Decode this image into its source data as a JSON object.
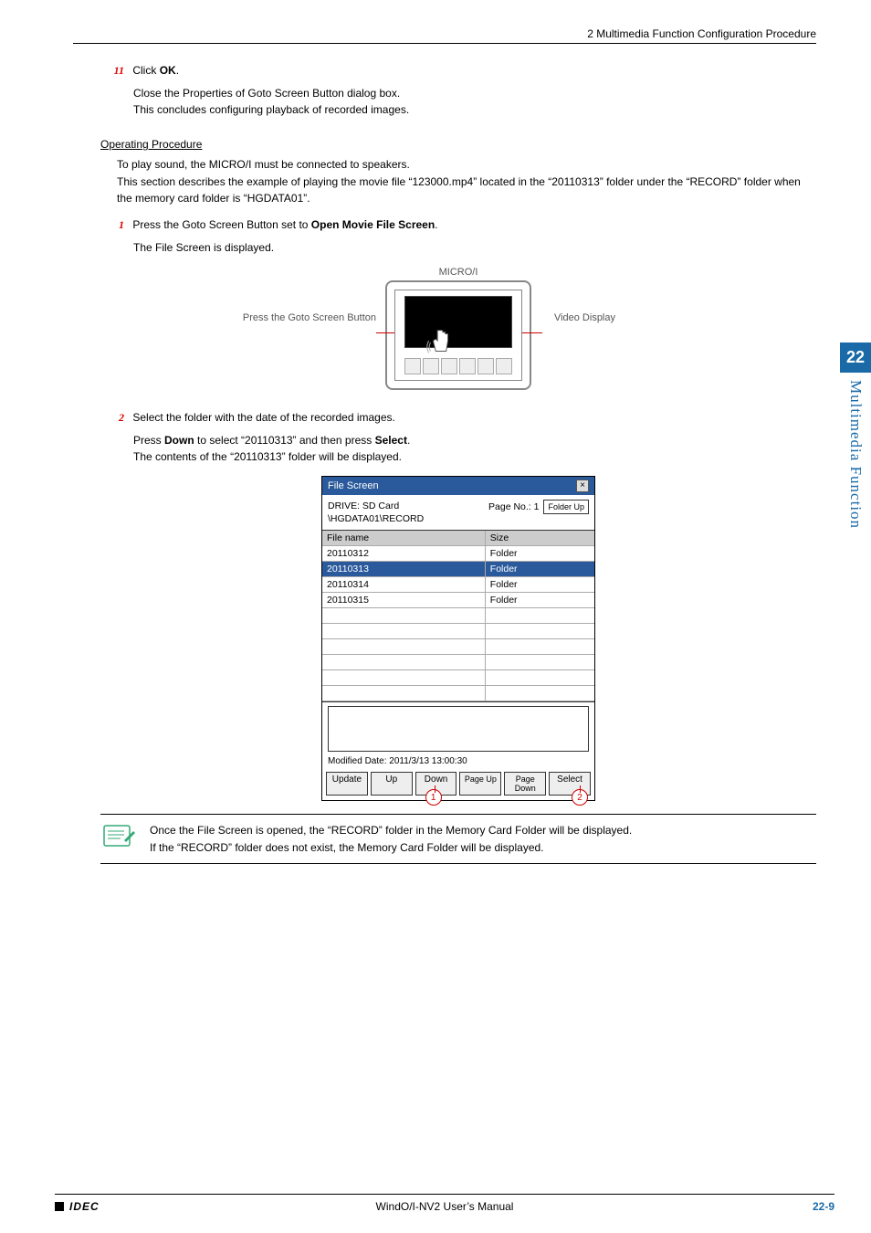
{
  "header": {
    "section_title": "2 Multimedia Function Configuration Procedure"
  },
  "step11": {
    "num": "11",
    "text_prefix": "Click ",
    "text_bold": "OK",
    "text_suffix": ".",
    "body_1": "Close the Properties of Goto Screen Button dialog box.",
    "body_2": "This concludes configuring playback of recorded images."
  },
  "op_heading": "Operating Procedure",
  "op_body_1": "To play sound, the MICRO/I must be connected to speakers.",
  "op_body_2": "This section describes the example of playing the movie file “123000.mp4” located in the “20110313” folder under the “RECORD” folder when the memory card folder is “HGDATA01”.",
  "step1": {
    "num": "1",
    "text_prefix": "Press the Goto Screen Button set to ",
    "text_bold": "Open Movie File Screen",
    "text_suffix": ".",
    "body_1": "The File Screen is displayed."
  },
  "diagram": {
    "title": "MICRO/I",
    "left_callout": "Press the Goto Screen Button",
    "right_callout": "Video Display"
  },
  "step2": {
    "num": "2",
    "text": "Select the folder with the date of the recorded images.",
    "body_1_prefix": "Press ",
    "body_1_bold1": "Down",
    "body_1_mid": " to select “20110313” and then press ",
    "body_1_bold2": "Select",
    "body_1_suffix": ".",
    "body_2": "The contents of the “20110313” folder will be displayed."
  },
  "filescreen": {
    "title": "File Screen",
    "close": "×",
    "drive": "DRIVE: SD Card",
    "path": "\\HGDATA01\\RECORD",
    "page_no": "Page No.: 1",
    "folder_up": "Folder Up",
    "col_name": "File name",
    "col_size": "Size",
    "rows": [
      {
        "name": "20110312",
        "size": "Folder",
        "selected": false
      },
      {
        "name": "20110313",
        "size": "Folder",
        "selected": true
      },
      {
        "name": "20110314",
        "size": "Folder",
        "selected": false
      },
      {
        "name": "20110315",
        "size": "Folder",
        "selected": false
      }
    ],
    "modified": "Modified Date: 2011/3/13 13:00:30",
    "buttons": [
      "Update",
      "Up",
      "Down",
      "Page Up",
      "Page Down",
      "Select"
    ],
    "callout1": "1",
    "callout2": "2"
  },
  "note": {
    "line1": "Once the File Screen is opened, the “RECORD” folder in the Memory Card Folder will be displayed.",
    "line2": "If the “RECORD” folder does not exist, the Memory Card Folder will be displayed."
  },
  "side": {
    "num": "22",
    "label": "Multimedia Function"
  },
  "footer": {
    "brand": "IDEC",
    "center": "WindO/I-NV2 User’s Manual",
    "page_major": "22-",
    "page_minor": "9"
  }
}
